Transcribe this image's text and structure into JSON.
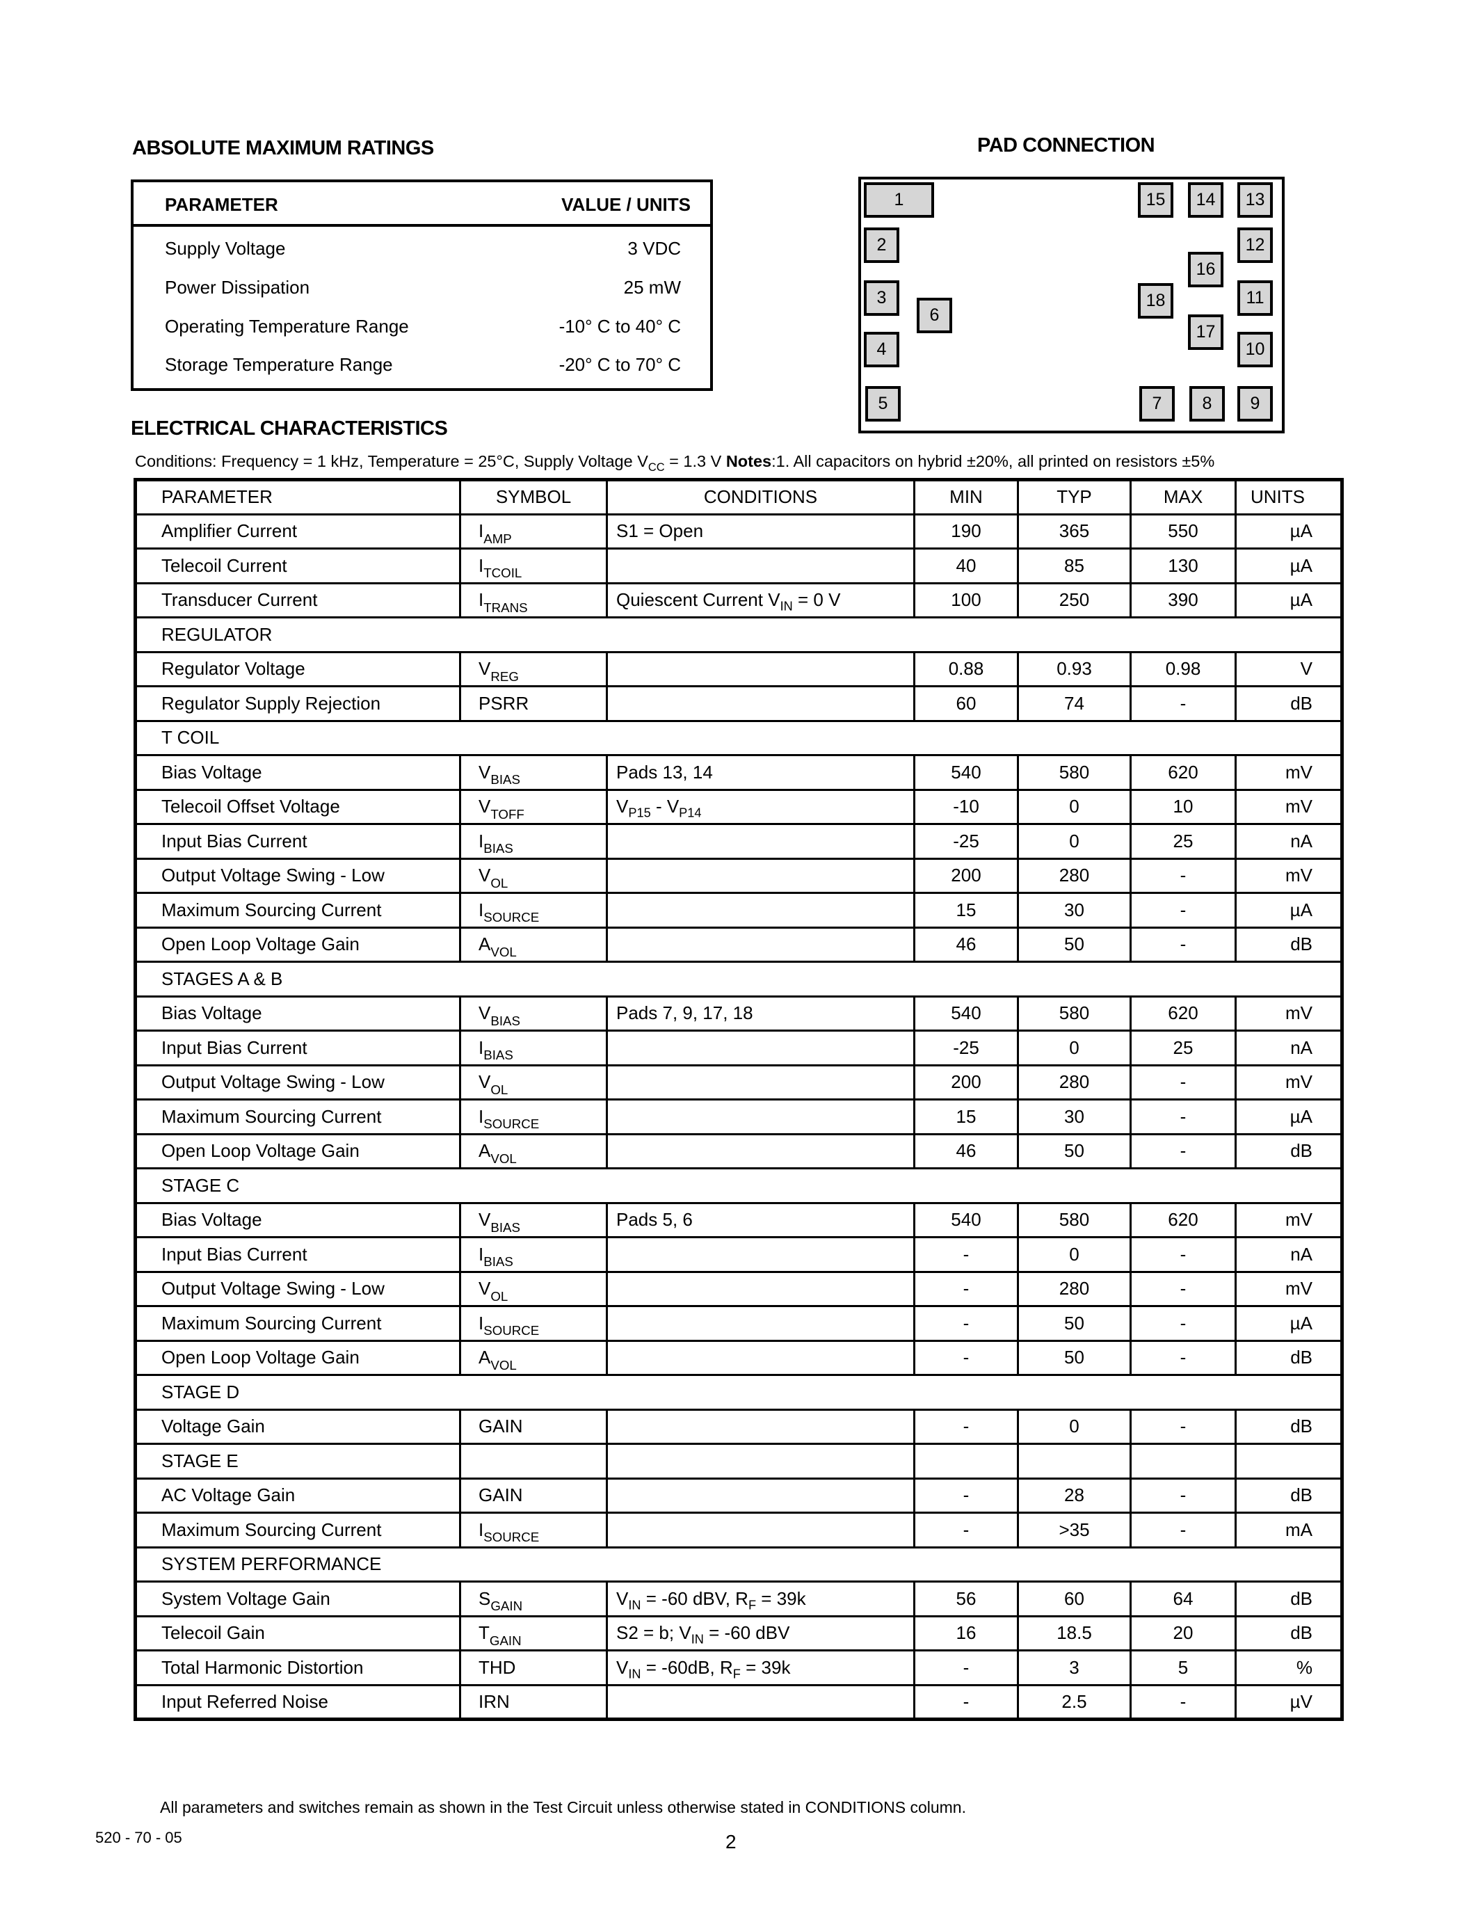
{
  "absolute_max_ratings": {
    "title": "ABSOLUTE MAXIMUM  RATINGS",
    "headers": {
      "parameter": "PARAMETER",
      "value": "VALUE / UNITS"
    },
    "rows": [
      {
        "parameter": "Supply Voltage",
        "value": "3 VDC"
      },
      {
        "parameter": "Power Dissipation",
        "value": "25 mW"
      },
      {
        "parameter": "Operating Temperature Range",
        "value": "-10° C to 40° C"
      },
      {
        "parameter": "Storage Temperature Range",
        "value": "-20° C to 70° C"
      }
    ]
  },
  "pad_connection": {
    "title": "PAD CONNECTION",
    "pads": [
      "1",
      "2",
      "3",
      "4",
      "5",
      "6",
      "7",
      "8",
      "9",
      "10",
      "11",
      "12",
      "13",
      "14",
      "15",
      "16",
      "17",
      "18"
    ]
  },
  "electrical": {
    "title": "ELECTRICAL CHARACTERISTICS",
    "conditions": {
      "prefix": "Conditions: Frequency = 1 kHz, Temperature = 25°C, Supply Voltage V",
      "sub": "CC",
      "suffix": " = 1.3 V  ",
      "notes_label": "Notes",
      "notes_text": ":1. All capacitors on hybrid ±20%, all printed on resistors ±5%"
    },
    "headers": [
      "PARAMETER",
      "SYMBOL",
      "CONDITIONS",
      "MIN",
      "TYP",
      "MAX",
      "UNITS"
    ],
    "rows": [
      {
        "type": "data",
        "parameter": "Amplifier Current",
        "symbol": "I",
        "symbol_sub": "AMP",
        "conditions": "S1 = Open",
        "min": "190",
        "typ": "365",
        "max": "550",
        "units": "µA"
      },
      {
        "type": "data",
        "parameter": "Telecoil Current",
        "symbol": "I",
        "symbol_sub": "TCOIL",
        "conditions": "",
        "min": "40",
        "typ": "85",
        "max": "130",
        "units": "µA"
      },
      {
        "type": "data",
        "parameter": "Transducer Current",
        "symbol": "I",
        "symbol_sub": "TRANS",
        "conditions": "Quiescent Current V<sub>IN</sub> = 0 V",
        "min": "100",
        "typ": "250",
        "max": "390",
        "units": "µA"
      },
      {
        "type": "section",
        "label": "REGULATOR"
      },
      {
        "type": "data",
        "parameter": "Regulator Voltage",
        "symbol": "V",
        "symbol_sub": "REG",
        "conditions": "",
        "min": "0.88",
        "typ": "0.93",
        "max": "0.98",
        "units": "V"
      },
      {
        "type": "data",
        "parameter": "Regulator Supply Rejection",
        "symbol": "PSRR",
        "symbol_sub": "",
        "conditions": "",
        "min": "60",
        "typ": "74",
        "max": "-",
        "units": "dB"
      },
      {
        "type": "section",
        "label": "T COIL"
      },
      {
        "type": "data",
        "parameter": "Bias Voltage",
        "symbol": "V",
        "symbol_sub": "BIAS",
        "conditions": "Pads 13, 14",
        "min": "540",
        "typ": "580",
        "max": "620",
        "units": "mV"
      },
      {
        "type": "data",
        "parameter": "Telecoil Offset Voltage",
        "symbol": "V",
        "symbol_sub": "TOFF",
        "conditions": "V<sub>P15</sub> - V<sub>P14</sub>",
        "min": "-10",
        "typ": "0",
        "max": "10",
        "units": "mV"
      },
      {
        "type": "data",
        "parameter": "Input Bias Current",
        "symbol": "I",
        "symbol_sub": "BIAS",
        "conditions": "",
        "min": "-25",
        "typ": "0",
        "max": "25",
        "units": "nA"
      },
      {
        "type": "data",
        "parameter": "Output Voltage Swing - Low",
        "symbol": "V",
        "symbol_sub": "OL",
        "conditions": "",
        "min": "200",
        "typ": "280",
        "max": "-",
        "units": "mV"
      },
      {
        "type": "data",
        "parameter": "Maximum Sourcing Current",
        "symbol": "I",
        "symbol_sub": "SOURCE",
        "conditions": "",
        "min": "15",
        "typ": "30",
        "max": "-",
        "units": "µA"
      },
      {
        "type": "data",
        "parameter": "Open Loop Voltage Gain",
        "symbol": "A",
        "symbol_sub": "VOL",
        "conditions": "",
        "min": "46",
        "typ": "50",
        "max": "-",
        "units": "dB"
      },
      {
        "type": "section",
        "label": "STAGES A & B"
      },
      {
        "type": "data",
        "parameter": "Bias Voltage",
        "symbol": "V",
        "symbol_sub": "BIAS",
        "conditions": "Pads 7, 9, 17, 18",
        "min": "540",
        "typ": "580",
        "max": "620",
        "units": "mV"
      },
      {
        "type": "data",
        "parameter": "Input Bias Current",
        "symbol": "I",
        "symbol_sub": "BIAS",
        "conditions": "",
        "min": "-25",
        "typ": "0",
        "max": "25",
        "units": "nA"
      },
      {
        "type": "data",
        "parameter": "Output Voltage Swing - Low",
        "symbol": "V",
        "symbol_sub": "OL",
        "conditions": "",
        "min": "200",
        "typ": "280",
        "max": "-",
        "units": "mV"
      },
      {
        "type": "data",
        "parameter": "Maximum Sourcing Current",
        "symbol": "I",
        "symbol_sub": "SOURCE",
        "conditions": "",
        "min": "15",
        "typ": "30",
        "max": "-",
        "units": "µA"
      },
      {
        "type": "data",
        "parameter": "Open Loop Voltage Gain",
        "symbol": "A",
        "symbol_sub": "VOL",
        "conditions": "",
        "min": "46",
        "typ": "50",
        "max": "-",
        "units": "dB"
      },
      {
        "type": "section",
        "label": "STAGE C"
      },
      {
        "type": "data",
        "parameter": "Bias Voltage",
        "symbol": "V",
        "symbol_sub": "BIAS",
        "conditions": "Pads 5, 6",
        "min": "540",
        "typ": "580",
        "max": "620",
        "units": "mV"
      },
      {
        "type": "data",
        "parameter": "Input Bias Current",
        "symbol": "I",
        "symbol_sub": "BIAS",
        "conditions": "",
        "min": "-",
        "typ": "0",
        "max": "-",
        "units": "nA"
      },
      {
        "type": "data",
        "parameter": "Output Voltage Swing - Low",
        "symbol": "V",
        "symbol_sub": "OL",
        "conditions": "",
        "min": "-",
        "typ": "280",
        "max": "-",
        "units": "mV"
      },
      {
        "type": "data",
        "parameter": "Maximum Sourcing Current",
        "symbol": "I",
        "symbol_sub": "SOURCE",
        "conditions": "",
        "min": "-",
        "typ": "50",
        "max": "-",
        "units": "µA"
      },
      {
        "type": "data",
        "parameter": "Open Loop Voltage Gain",
        "symbol": "A",
        "symbol_sub": "VOL",
        "conditions": "",
        "min": "-",
        "typ": "50",
        "max": "-",
        "units": "dB"
      },
      {
        "type": "section",
        "label": "STAGE D"
      },
      {
        "type": "data",
        "parameter": "Voltage Gain",
        "symbol": "GAIN",
        "symbol_sub": "",
        "conditions": "",
        "min": "-",
        "typ": "0",
        "max": "-",
        "units": "dB"
      },
      {
        "type": "data",
        "parameter": "STAGE E",
        "symbol": "",
        "symbol_sub": "",
        "conditions": "",
        "min": "",
        "typ": "",
        "max": "",
        "units": ""
      },
      {
        "type": "data",
        "parameter": "AC Voltage Gain",
        "symbol": "GAIN",
        "symbol_sub": "",
        "conditions": "",
        "min": "-",
        "typ": "28",
        "max": "-",
        "units": "dB"
      },
      {
        "type": "data",
        "parameter": "Maximum Sourcing Current",
        "symbol": "I",
        "symbol_sub": "SOURCE",
        "conditions": "",
        "min": "-",
        "typ": ">35",
        "max": "-",
        "units": "mA"
      },
      {
        "type": "section",
        "label": "SYSTEM PERFORMANCE"
      },
      {
        "type": "data",
        "parameter": "System Voltage Gain",
        "symbol": "S",
        "symbol_sub": "GAIN",
        "conditions": "V<sub>IN</sub> = -60 dBV, R<sub>F</sub> = 39k",
        "min": "56",
        "typ": "60",
        "max": "64",
        "units": "dB"
      },
      {
        "type": "data",
        "parameter": "Telecoil Gain",
        "symbol": "T",
        "symbol_sub": "GAIN",
        "conditions": "S2 = b; V<sub>IN</sub> = -60 dBV",
        "min": "16",
        "typ": "18.5",
        "max": "20",
        "units": "dB"
      },
      {
        "type": "data",
        "parameter": "Total Harmonic Distortion",
        "symbol": "THD",
        "symbol_sub": "",
        "conditions": "V<sub>IN</sub> = -60dB, R<sub>F</sub> = 39k",
        "min": "-",
        "typ": "3",
        "max": "5",
        "units": "%"
      },
      {
        "type": "data",
        "parameter": "Input Referred Noise",
        "symbol": "IRN",
        "symbol_sub": "",
        "conditions": "",
        "min": "-",
        "typ": "2.5",
        "max": "-",
        "units": "µV"
      }
    ],
    "footnote": "All parameters and switches remain as shown in the Test Circuit unless otherwise stated in CONDITIONS column."
  },
  "footer": {
    "doc_code": "520 - 70 - 05",
    "page_number": "2"
  }
}
